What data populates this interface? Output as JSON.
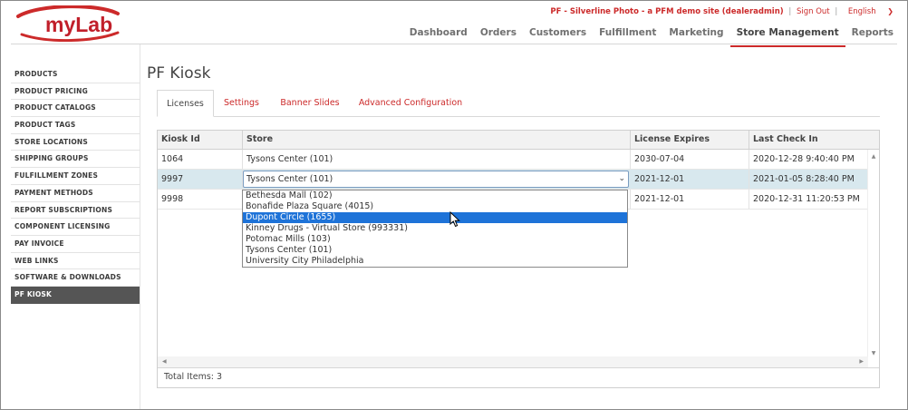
{
  "header": {
    "logo_text": "myLab",
    "site_label": "PF - Silverline Photo - a PFM demo site (dealeradmin)",
    "sign_out": "Sign Out",
    "language": "English",
    "nav": [
      {
        "label": "Dashboard"
      },
      {
        "label": "Orders"
      },
      {
        "label": "Customers"
      },
      {
        "label": "Fulfillment"
      },
      {
        "label": "Marketing"
      },
      {
        "label": "Store Management"
      },
      {
        "label": "Reports"
      }
    ],
    "active_nav": "Store Management"
  },
  "sidebar": {
    "items": [
      {
        "label": "PRODUCTS"
      },
      {
        "label": "PRODUCT PRICING"
      },
      {
        "label": "PRODUCT CATALOGS"
      },
      {
        "label": "PRODUCT TAGS"
      },
      {
        "label": "STORE LOCATIONS"
      },
      {
        "label": "SHIPPING GROUPS"
      },
      {
        "label": "FULFILLMENT ZONES"
      },
      {
        "label": "PAYMENT METHODS"
      },
      {
        "label": "REPORT SUBSCRIPTIONS"
      },
      {
        "label": "COMPONENT LICENSING"
      },
      {
        "label": "PAY INVOICE"
      },
      {
        "label": "WEB LINKS"
      },
      {
        "label": "SOFTWARE & DOWNLOADS"
      },
      {
        "label": "PF KIOSK"
      }
    ],
    "active": "PF KIOSK"
  },
  "main": {
    "title": "PF Kiosk",
    "tabs": [
      {
        "label": "Licenses"
      },
      {
        "label": "Settings"
      },
      {
        "label": "Banner Slides"
      },
      {
        "label": "Advanced Configuration"
      }
    ],
    "active_tab": "Licenses",
    "grid": {
      "columns": [
        "Kiosk Id",
        "Store",
        "License Expires",
        "Last Check In"
      ],
      "rows": [
        {
          "kiosk_id": "1064",
          "store": "Tysons Center (101)",
          "expires": "2030-07-04",
          "last_check_in": "2020-12-28 9:40:40 PM"
        },
        {
          "kiosk_id": "9997",
          "store": "Tysons Center (101)",
          "expires": "2021-12-01",
          "last_check_in": "2021-01-05 8:28:40 PM"
        },
        {
          "kiosk_id": "9998",
          "store": "",
          "expires": "2021-12-01",
          "last_check_in": "2020-12-31 11:20:53 PM"
        }
      ],
      "editing_row": 1,
      "dropdown_options": [
        "Bethesda Mall (102)",
        "Bonafide Plaza Square (4015)",
        "Dupont Circle (1655)",
        "Kinney Drugs - Virtual Store (993331)",
        "Potomac Mills (103)",
        "Tysons Center (101)",
        "University City Philadelphia"
      ],
      "highlighted_option": "Dupont Circle (1655)",
      "footer": "Total Items: 3"
    }
  },
  "colors": {
    "brand_red": "#cc2a2a",
    "selected_row": "#d8e8ee",
    "option_highlight": "#1e73d8",
    "sidebar_active": "#555555"
  }
}
